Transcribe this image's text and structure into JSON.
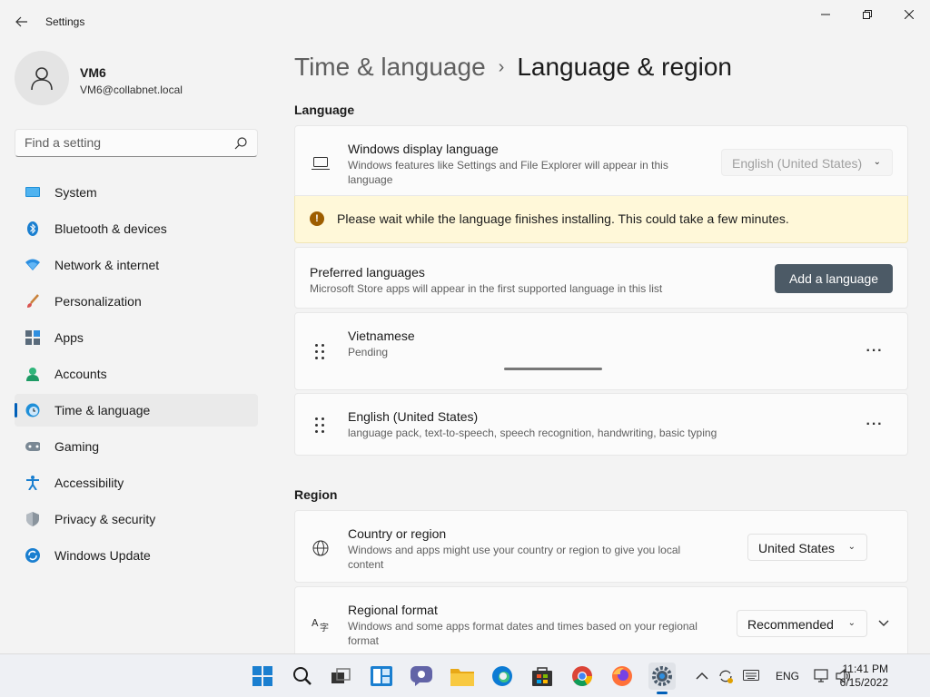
{
  "window": {
    "title": "Settings"
  },
  "profile": {
    "name": "VM6",
    "email": "VM6@collabnet.local"
  },
  "search": {
    "placeholder": "Find a setting"
  },
  "sidebar": {
    "items": [
      {
        "label": "System",
        "icon": "system-icon"
      },
      {
        "label": "Bluetooth & devices",
        "icon": "bluetooth-icon"
      },
      {
        "label": "Network & internet",
        "icon": "network-icon"
      },
      {
        "label": "Personalization",
        "icon": "brush-icon"
      },
      {
        "label": "Apps",
        "icon": "apps-icon"
      },
      {
        "label": "Accounts",
        "icon": "accounts-icon"
      },
      {
        "label": "Time & language",
        "icon": "time-language-icon",
        "active": true
      },
      {
        "label": "Gaming",
        "icon": "gaming-icon"
      },
      {
        "label": "Accessibility",
        "icon": "accessibility-icon"
      },
      {
        "label": "Privacy & security",
        "icon": "shield-icon"
      },
      {
        "label": "Windows Update",
        "icon": "update-icon"
      }
    ]
  },
  "breadcrumb": {
    "parent": "Time & language",
    "separator": "›",
    "current": "Language & region"
  },
  "language_section": {
    "title": "Language",
    "display_language": {
      "title": "Windows display language",
      "description": "Windows features like Settings and File Explorer will appear in this language",
      "value": "English (United States)"
    },
    "banner": {
      "icon": "warning-icon",
      "text": "Please wait while the language finishes installing. This could take a few minutes."
    },
    "preferred": {
      "title": "Preferred languages",
      "description": "Microsoft Store apps will appear in the first supported language in this list",
      "button": "Add a language"
    },
    "languages": [
      {
        "name": "Vietnamese",
        "status": "Pending"
      },
      {
        "name": "English (United States)",
        "status": "language pack, text-to-speech, speech recognition, handwriting, basic typing"
      }
    ],
    "more_label": "···"
  },
  "region_section": {
    "title": "Region",
    "country": {
      "title": "Country or region",
      "description": "Windows and apps might use your country or region to give you local content",
      "value": "United States"
    },
    "format": {
      "title": "Regional format",
      "description": "Windows and some apps format dates and times based on your regional format",
      "value": "Recommended"
    }
  },
  "taskbar": {
    "tray_language": "ENG",
    "time": "11:41 PM",
    "date": "6/15/2022"
  },
  "colors": {
    "accent": "#005fb8",
    "banner_bg": "#fff8d9",
    "button": "#4c5a66"
  }
}
